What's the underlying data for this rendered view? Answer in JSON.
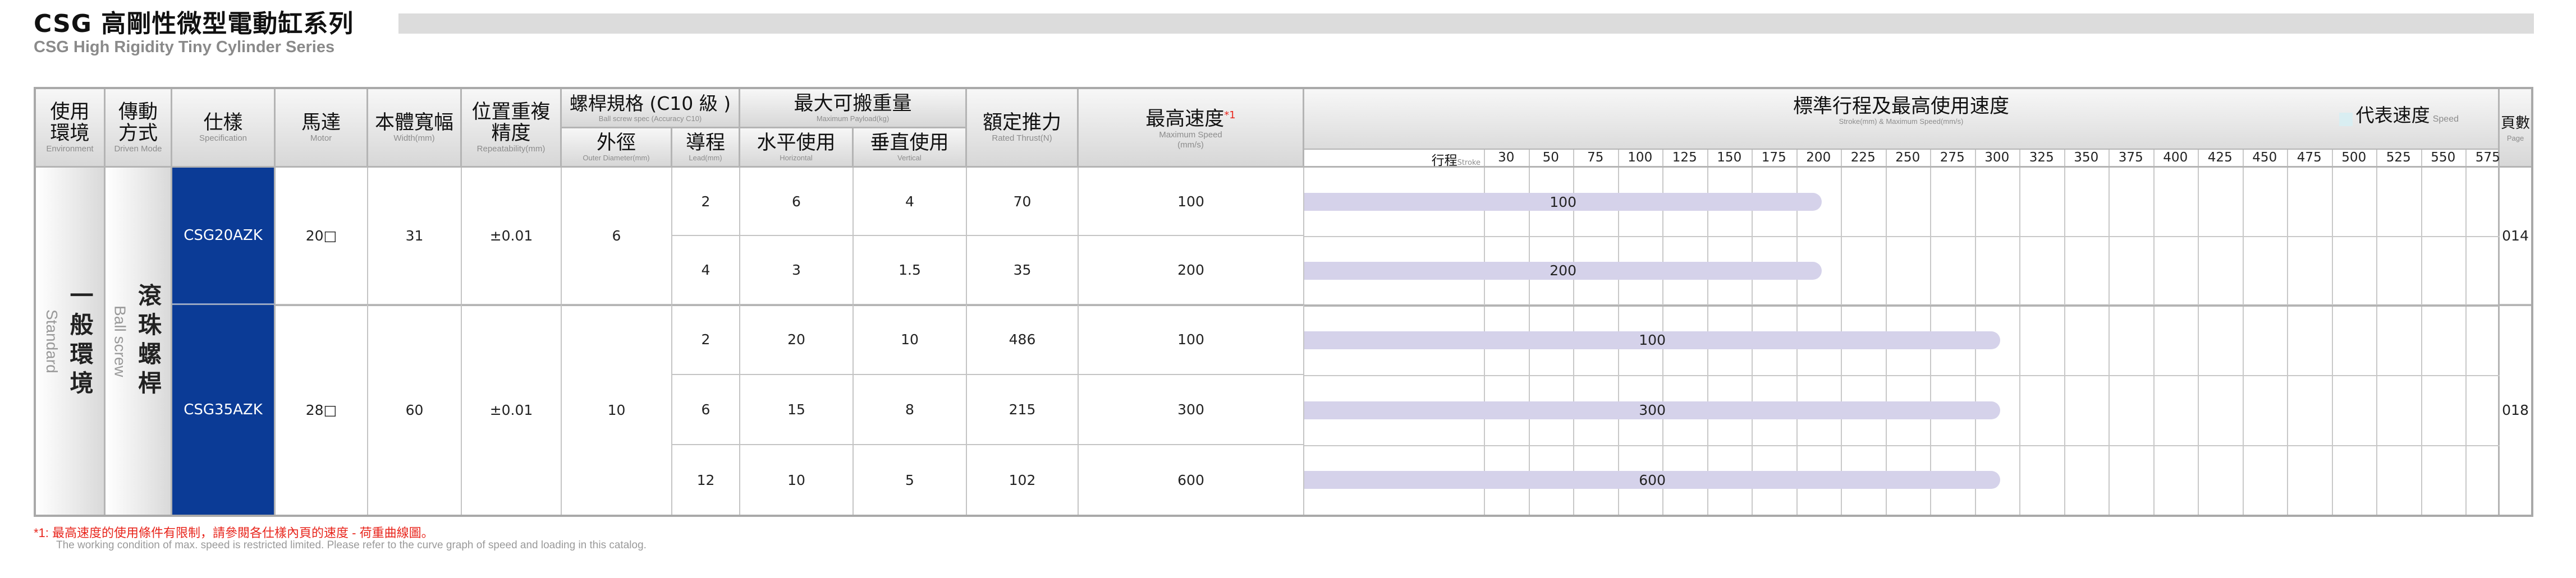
{
  "header": {
    "title": "CSG 高剛性微型電動缸系列",
    "subtitle": "CSG High Rigidity Tiny Cylinder Series"
  },
  "columns": {
    "environment": {
      "zh": "使用\n環境",
      "en": "Environment"
    },
    "drive": {
      "zh": "傳動\n方式",
      "en": "Driven Mode"
    },
    "spec": {
      "zh": "仕樣",
      "en": "Specification"
    },
    "motor": {
      "zh": "馬達",
      "en": "Motor"
    },
    "width": {
      "zh": "本體寬幅",
      "en": "Width(mm)"
    },
    "repeat": {
      "zh": "位置重複\n精度",
      "en": "Repeatability(mm)"
    },
    "screw": {
      "zh": "螺桿規格 (C10 級 )",
      "en": "Ball screw spec (Accuracy C10)"
    },
    "outer": {
      "zh": "外徑",
      "en": "Outer Diameter(mm)"
    },
    "lead": {
      "zh": "導程",
      "en": "Lead(mm)"
    },
    "payload": {
      "zh": "最大可搬重量",
      "en": "Maximum Payload(kg)"
    },
    "horizontal": {
      "zh": "水平使用",
      "en": "Horizontal"
    },
    "vertical": {
      "zh": "垂直使用",
      "en": "Vertical"
    },
    "thrust": {
      "zh": "額定推力",
      "en": "Rated Thrust(N)"
    },
    "speed": {
      "zh": "最高速度",
      "sup": "*1",
      "en": "Maximum Speed",
      "unit": "(mm/s)"
    },
    "stroke": {
      "zh": "標準行程及最高使用速度",
      "en": "Stroke(mm) & Maximum Speed(mm/s)"
    },
    "legend": {
      "zh": "代表速度",
      "en": "Speed"
    },
    "page": {
      "zh": "頁數",
      "en": "Page"
    },
    "stroke_label": {
      "zh": "行程",
      "en": "Stroke"
    }
  },
  "stroke_ticks": [
    "30",
    "50",
    "75",
    "100",
    "125",
    "150",
    "175",
    "200",
    "225",
    "250",
    "275",
    "300",
    "325",
    "350",
    "375",
    "400",
    "425",
    "450",
    "475",
    "500",
    "525",
    "550",
    "575"
  ],
  "environment_value": {
    "zh": "一般環境",
    "en": "Standard"
  },
  "drive_value": {
    "zh": "滾珠螺桿",
    "en": "Ball screw"
  },
  "groups": [
    {
      "spec": "CSG20AZK",
      "motor": "20□",
      "width": "31",
      "repeat": "±0.01",
      "outer": "6",
      "page": "014",
      "rows": [
        {
          "lead": "2",
          "horizontal": "6",
          "vertical": "4",
          "thrust": "70",
          "speed": "100",
          "max_stroke": 200,
          "bar_label": "100"
        },
        {
          "lead": "4",
          "horizontal": "3",
          "vertical": "1.5",
          "thrust": "35",
          "speed": "200",
          "max_stroke": 200,
          "bar_label": "200"
        }
      ]
    },
    {
      "spec": "CSG35AZK",
      "motor": "28□",
      "width": "60",
      "repeat": "±0.01",
      "outer": "10",
      "page": "018",
      "rows": [
        {
          "lead": "2",
          "horizontal": "20",
          "vertical": "10",
          "thrust": "486",
          "speed": "100",
          "max_stroke": 300,
          "bar_label": "100"
        },
        {
          "lead": "6",
          "horizontal": "15",
          "vertical": "8",
          "thrust": "215",
          "speed": "300",
          "max_stroke": 300,
          "bar_label": "300"
        },
        {
          "lead": "12",
          "horizontal": "10",
          "vertical": "5",
          "thrust": "102",
          "speed": "600",
          "max_stroke": 300,
          "bar_label": "600"
        }
      ]
    }
  ],
  "footnote": {
    "zh": "*1: 最高速度的使用條件有限制，請參閱各仕樣內頁的速度 - 荷重曲線圖。",
    "en": "The working condition of max. speed is restricted limited. Please refer to the curve graph of speed and loading in this catalog."
  },
  "colors": {
    "spec_bg": "#0b3b96",
    "bar": "#d5d2ea",
    "legend": "#d9eef2",
    "note": "#e8251c"
  }
}
